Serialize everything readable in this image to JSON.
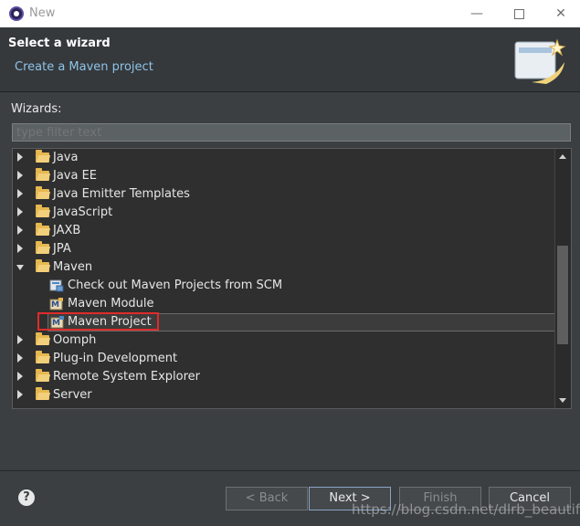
{
  "window": {
    "title": "New",
    "controls": [
      "minimize",
      "maximize",
      "close"
    ]
  },
  "banner": {
    "title": "Select a wizard",
    "description": "Create a Maven project"
  },
  "wizards": {
    "label": "Wizards:",
    "filter_placeholder": "type filter text"
  },
  "tree": {
    "items": [
      {
        "label": "Java",
        "type": "folder",
        "expanded": false,
        "level": 0
      },
      {
        "label": "Java EE",
        "type": "folder",
        "expanded": false,
        "level": 0
      },
      {
        "label": "Java Emitter Templates",
        "type": "folder",
        "expanded": false,
        "level": 0
      },
      {
        "label": "JavaScript",
        "type": "folder",
        "expanded": false,
        "level": 0
      },
      {
        "label": "JAXB",
        "type": "folder",
        "expanded": false,
        "level": 0
      },
      {
        "label": "JPA",
        "type": "folder",
        "expanded": false,
        "level": 0
      },
      {
        "label": "Maven",
        "type": "folder",
        "expanded": true,
        "level": 0
      },
      {
        "label": "Check out Maven Projects from SCM",
        "type": "maven-checkout",
        "level": 1
      },
      {
        "label": "Maven Module",
        "type": "maven-module",
        "level": 1
      },
      {
        "label": "Maven Project",
        "type": "maven-project",
        "level": 1,
        "selected": true
      },
      {
        "label": "Oomph",
        "type": "folder",
        "expanded": false,
        "level": 0
      },
      {
        "label": "Plug-in Development",
        "type": "folder",
        "expanded": false,
        "level": 0
      },
      {
        "label": "Remote System Explorer",
        "type": "folder",
        "expanded": false,
        "level": 0
      },
      {
        "label": "Server",
        "type": "folder",
        "expanded": false,
        "level": 0
      }
    ]
  },
  "buttons": {
    "help": "?",
    "back": "< Back",
    "next": "Next >",
    "finish": "Finish",
    "cancel": "Cancel"
  },
  "watermark": "https://blog.csdn.net/dlrb_beautiful",
  "colors": {
    "background": "#3b3f42",
    "banner_desc": "#8fc3e6",
    "highlight": "#e02b2b",
    "folder": "#e6b84f"
  }
}
